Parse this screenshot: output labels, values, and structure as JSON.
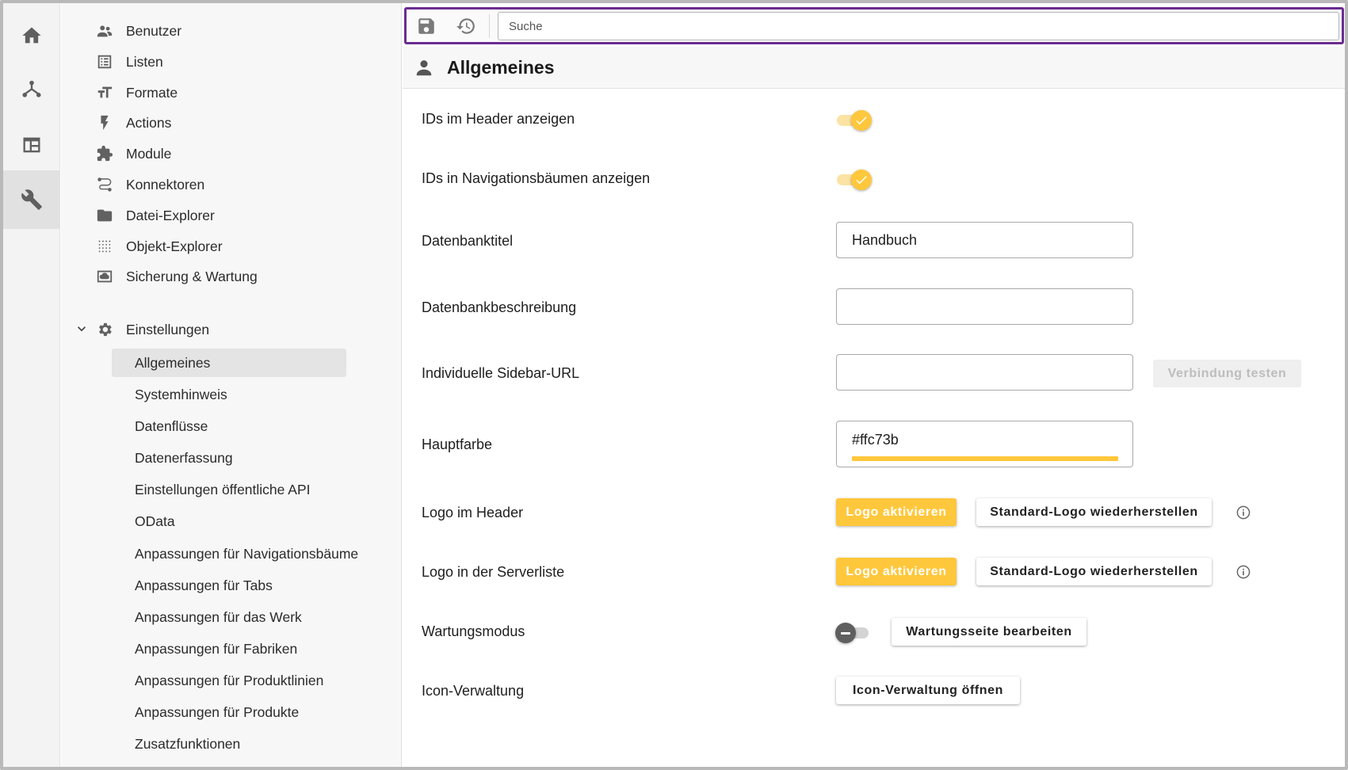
{
  "rail": {
    "items": [
      {
        "icon": "home-icon"
      },
      {
        "icon": "hierarchy-icon"
      },
      {
        "icon": "window-icon"
      },
      {
        "icon": "wrench-icon",
        "active": true
      }
    ]
  },
  "nav": {
    "items": [
      {
        "label": "Benutzer",
        "icon": "users-icon"
      },
      {
        "label": "Listen",
        "icon": "list-icon"
      },
      {
        "label": "Formate",
        "icon": "text-format-icon"
      },
      {
        "label": "Actions",
        "icon": "lightning-icon"
      },
      {
        "label": "Module",
        "icon": "puzzle-icon"
      },
      {
        "label": "Konnektoren",
        "icon": "connector-icon"
      },
      {
        "label": "Datei-Explorer",
        "icon": "folder-icon"
      },
      {
        "label": "Objekt-Explorer",
        "icon": "dots-grid-icon"
      },
      {
        "label": "Sicherung & Wartung",
        "icon": "backup-icon"
      },
      {
        "label": "Einstellungen",
        "icon": "gear-icon"
      }
    ],
    "sub_items": [
      {
        "label": "Allgemeines",
        "active": true
      },
      {
        "label": "Systemhinweis"
      },
      {
        "label": "Datenflüsse"
      },
      {
        "label": "Datenerfassung"
      },
      {
        "label": "Einstellungen öffentliche API"
      },
      {
        "label": "OData"
      },
      {
        "label": "Anpassungen für Navigationsbäume"
      },
      {
        "label": "Anpassungen für Tabs"
      },
      {
        "label": "Anpassungen für das Werk"
      },
      {
        "label": "Anpassungen für Fabriken"
      },
      {
        "label": "Anpassungen für Produktlinien"
      },
      {
        "label": "Anpassungen für Produkte"
      },
      {
        "label": "Zusatzfunktionen"
      }
    ]
  },
  "toolbar": {
    "search_placeholder": "Suche"
  },
  "section": {
    "title": "Allgemeines"
  },
  "settings": {
    "ids_header": {
      "label": "IDs im Header anzeigen",
      "enabled": true
    },
    "ids_nav": {
      "label": "IDs in Navigationsbäumen anzeigen",
      "enabled": true
    },
    "db_title": {
      "label": "Datenbanktitel",
      "value": "Handbuch"
    },
    "db_desc": {
      "label": "Datenbankbeschreibung",
      "value": ""
    },
    "sidebar_url": {
      "label": "Individuelle Sidebar-URL",
      "value": "",
      "test_button": "Verbindung testen"
    },
    "main_color": {
      "label": "Hauptfarbe",
      "value": "#ffc73b",
      "swatch": "#ffc73b"
    },
    "logo_header": {
      "label": "Logo im Header",
      "activate": "Logo aktivieren",
      "restore": "Standard-Logo wiederherstellen"
    },
    "logo_server": {
      "label": "Logo in der Serverliste",
      "activate": "Logo aktivieren",
      "restore": "Standard-Logo wiederherstellen"
    },
    "maintenance": {
      "label": "Wartungsmodus",
      "enabled": false,
      "edit": "Wartungsseite bearbeiten"
    },
    "icon_admin": {
      "label": "Icon-Verwaltung",
      "open": "Icon-Verwaltung öffnen"
    }
  },
  "colors": {
    "accent": "#ffc73b",
    "focus_border": "#6a2c91"
  }
}
